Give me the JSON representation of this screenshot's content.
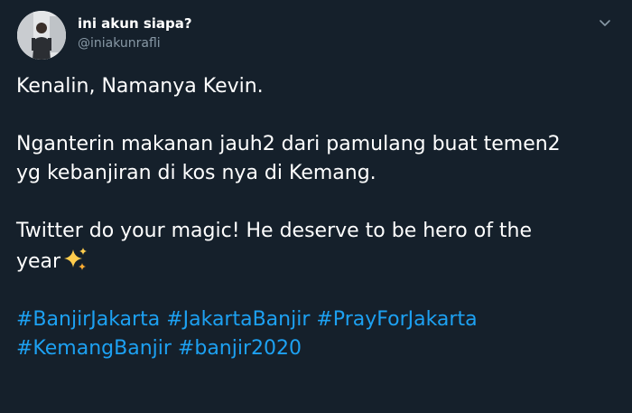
{
  "tweet": {
    "display_name": "ini akun siapa?",
    "handle": "@iniakunrafli",
    "line1": "Kenalin, Namanya Kevin.",
    "line2": "Nganterin makanan jauh2 dari pamulang buat temen2",
    "line3": "yg kebanjiran di kos nya di Kemang.",
    "line4": "Twitter do your magic! He deserve to be hero of the",
    "line5": "year",
    "emoji_icon": "sparkles-icon",
    "hashtags": [
      "#BanjirJakarta",
      "#JakartaBanjir",
      "#PrayForJakarta",
      "#KemangBanjir",
      "#banjir2020"
    ]
  },
  "colors": {
    "background": "#15202b",
    "text": "#ffffff",
    "muted": "#8899a6",
    "link": "#1da1f2"
  }
}
